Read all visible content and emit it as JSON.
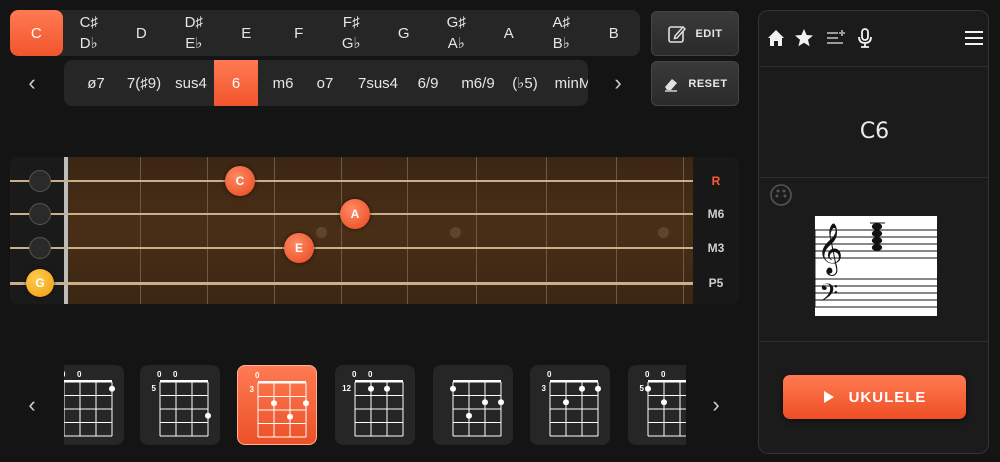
{
  "keys": [
    {
      "top": "C",
      "bottom": "",
      "active": true
    },
    {
      "top": "C♯",
      "bottom": "D♭"
    },
    {
      "top": "D",
      "bottom": ""
    },
    {
      "top": "D♯",
      "bottom": "E♭"
    },
    {
      "top": "E",
      "bottom": ""
    },
    {
      "top": "F",
      "bottom": ""
    },
    {
      "top": "F♯",
      "bottom": "G♭"
    },
    {
      "top": "G",
      "bottom": ""
    },
    {
      "top": "G♯",
      "bottom": "A♭"
    },
    {
      "top": "A",
      "bottom": ""
    },
    {
      "top": "A♯",
      "bottom": "B♭"
    },
    {
      "top": "B",
      "bottom": ""
    }
  ],
  "chord_types": [
    "ø7",
    "7(♯9)",
    "sus4",
    "6",
    "m6",
    "o7",
    "7sus4",
    "6/9",
    "m6/9",
    "(♭5)",
    "minM"
  ],
  "active_chord_type": "6",
  "buttons": {
    "edit": "EDIT",
    "reset": "RESET"
  },
  "fretboard": {
    "intervals": [
      "R",
      "M6",
      "M3",
      "P5"
    ],
    "notes": [
      {
        "label": "C",
        "string": 1,
        "fret": 3
      },
      {
        "label": "A",
        "string": 2,
        "fret": 5
      },
      {
        "label": "E",
        "string": 3,
        "fret": 4
      },
      {
        "label": "G",
        "string": 4,
        "fret": 0
      }
    ],
    "marker_frets": [
      5,
      7,
      10
    ]
  },
  "diagrams": [
    {
      "start_fret": "",
      "top_marks": [
        "0",
        "0"
      ],
      "active": false
    },
    {
      "start_fret": "5",
      "top_marks": [
        "0",
        "0"
      ],
      "active": false
    },
    {
      "start_fret": "3",
      "top_marks": [
        "0"
      ],
      "active": true
    },
    {
      "start_fret": "12",
      "top_marks": [
        "0",
        "0"
      ],
      "active": false
    },
    {
      "start_fret": "",
      "top_marks": [],
      "active": false
    },
    {
      "start_fret": "3",
      "top_marks": [
        "0"
      ],
      "active": false
    },
    {
      "start_fret": "5",
      "top_marks": [
        "0",
        "0"
      ],
      "active": false
    }
  ],
  "panel": {
    "chord_name": "C6",
    "play_label": "UKULELE"
  },
  "colors": {
    "accent": "#f2552c",
    "open_note": "#f09a10"
  }
}
